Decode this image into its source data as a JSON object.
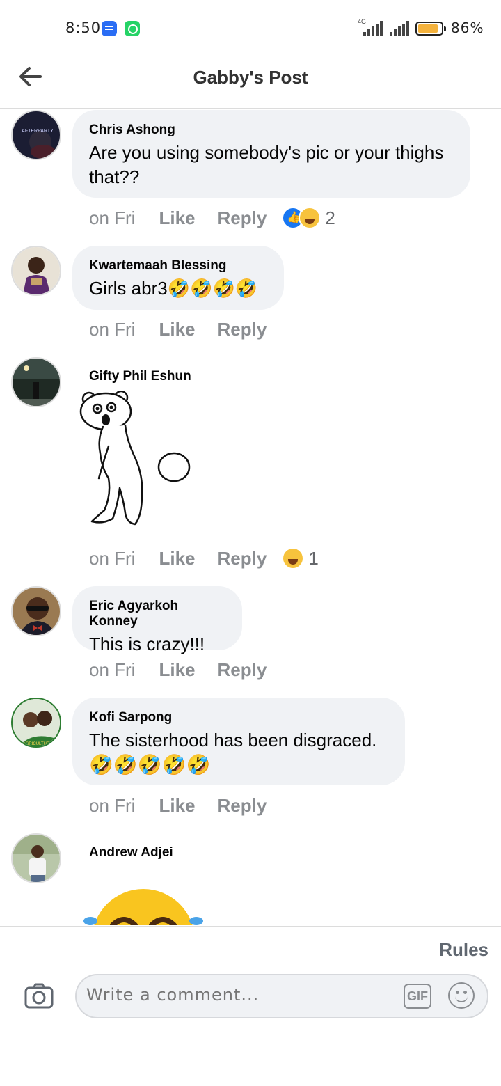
{
  "status_bar": {
    "time": "8:50",
    "network": "4G",
    "battery": "86%",
    "battery_level": 0.86
  },
  "header": {
    "title": "Gabby's Post"
  },
  "comments": [
    {
      "author": "Chris Ashong",
      "text": "Are you using somebody's pic or your thighs that??",
      "avatar_text": "AFTERPARTY",
      "time": "on Fri",
      "like_label": "Like",
      "reply_label": "Reply",
      "reaction_count": "2"
    },
    {
      "author": "Kwartemaah Blessing",
      "text": "Girls abr3🤣🤣🤣🤣",
      "time": "on Fri",
      "like_label": "Like",
      "reply_label": "Reply"
    },
    {
      "author": "Gifty Phil Eshun",
      "sticker": "bear-sticker",
      "time": "on Fri",
      "like_label": "Like",
      "reply_label": "Reply",
      "reaction_count": "1"
    },
    {
      "author": "Eric Agyarkoh Konney",
      "text": "This is crazy!!!",
      "time": "on Fri",
      "like_label": "Like",
      "reply_label": "Reply"
    },
    {
      "author": "Kofi Sarpong",
      "text": "The sisterhood has been disgraced.",
      "emoji_line": "🤣🤣🤣🤣🤣",
      "avatar_text": "AGRICULTURE",
      "time": "on Fri",
      "like_label": "Like",
      "reply_label": "Reply"
    },
    {
      "author": "Andrew Adjei",
      "sticker": "crying-laughing-emoji"
    }
  ],
  "footer": {
    "rules_label": "Rules",
    "comment_placeholder": "Write a comment...",
    "gif_label": "GIF"
  },
  "colors": {
    "bubble": "#f0f2f5",
    "meta_text": "#8a8d91",
    "like_blue": "#1877f2",
    "haha_yellow": "#f7c33d"
  }
}
